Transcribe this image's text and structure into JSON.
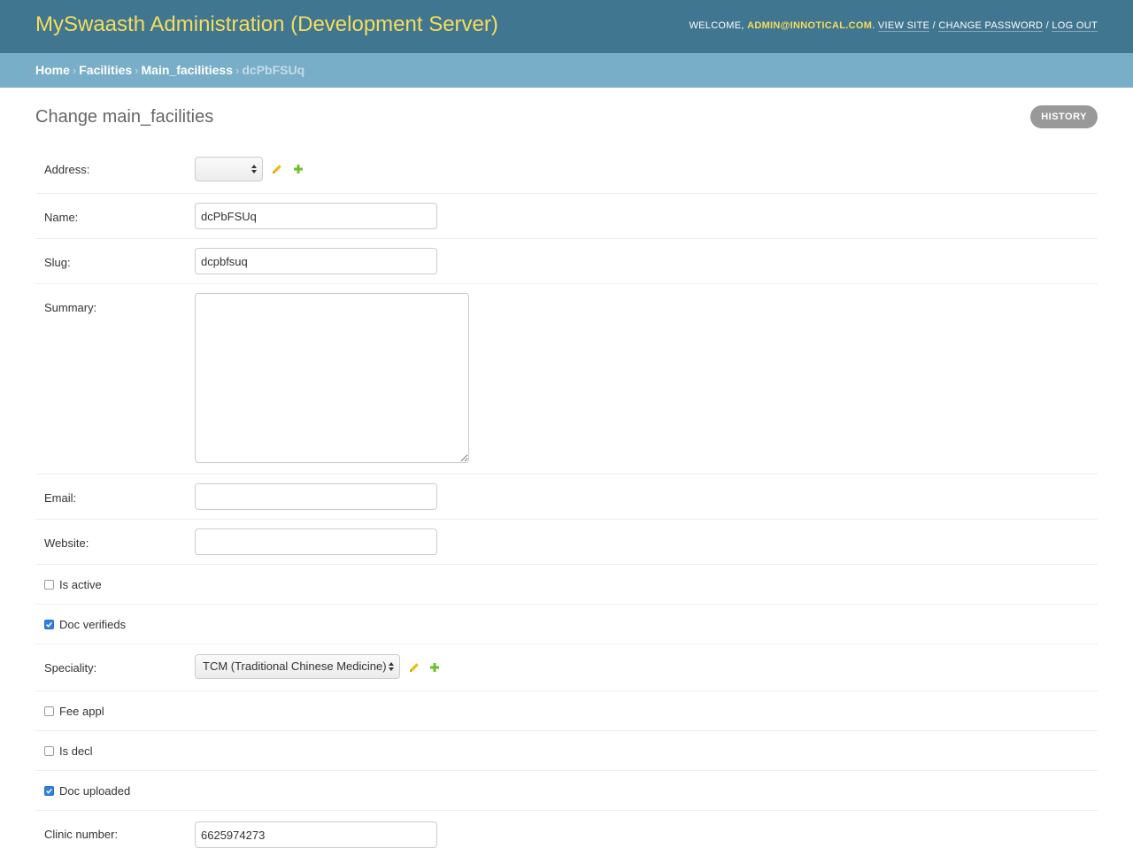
{
  "header": {
    "site_name": "MySwaasth Administration (Development Server)",
    "welcome": "Welcome,",
    "user": "admin@innotical.com",
    "view_site": "View site",
    "change_password": "Change password",
    "log_out": "Log out"
  },
  "breadcrumbs": {
    "home": "Home",
    "facilities": "Facilities",
    "main_facilitiess": "Main_facilitiess",
    "current": "dcPbFSUq"
  },
  "page": {
    "title": "Change main_facilities",
    "history": "History"
  },
  "fields": {
    "address": {
      "label": "Address:",
      "value": ""
    },
    "name": {
      "label": "Name:",
      "value": "dcPbFSUq"
    },
    "slug": {
      "label": "Slug:",
      "value": "dcpbfsuq"
    },
    "summary": {
      "label": "Summary:",
      "value": ""
    },
    "email": {
      "label": "Email:",
      "value": ""
    },
    "website": {
      "label": "Website:",
      "value": ""
    },
    "is_active": {
      "label": "Is active",
      "checked": false
    },
    "doc_verifieds": {
      "label": "Doc verifieds",
      "checked": true
    },
    "speciality": {
      "label": "Speciality:",
      "value": "TCM (Traditional Chinese Medicine)"
    },
    "fee_appl": {
      "label": "Fee appl",
      "checked": false
    },
    "is_decl": {
      "label": "Is decl",
      "checked": false
    },
    "doc_uploaded": {
      "label": "Doc uploaded",
      "checked": true
    },
    "clinic_number": {
      "label": "Clinic number:",
      "value": "6625974273"
    }
  },
  "icons": {
    "edit": "pencil-icon",
    "add": "plus-icon"
  },
  "colors": {
    "header_bg": "#417690",
    "site_name": "#f5dd5d",
    "breadcrumb_bg": "#79aec8",
    "edit_icon": "#efb80b",
    "add_icon": "#70bf2b",
    "checkbox_checked": "#2f7fe0"
  }
}
